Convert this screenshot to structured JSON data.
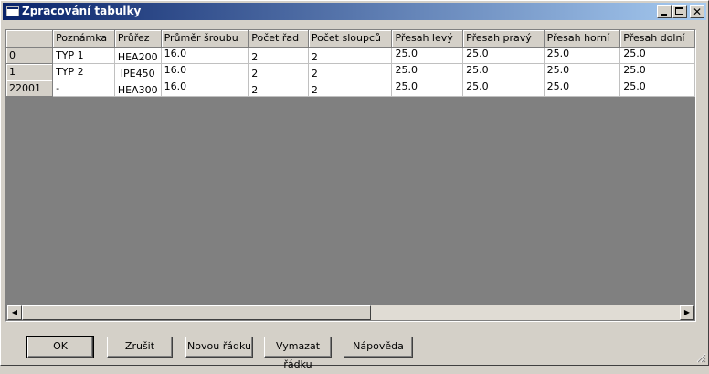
{
  "window": {
    "title": "Zpracování tabulky"
  },
  "grid": {
    "columns": [
      "",
      "Poznámka",
      "Průřez",
      "Průměr šroubu",
      "Počet řad",
      "Počet sloupců",
      "Přesah levý",
      "Přesah pravý",
      "Přesah horní",
      "Přesah dolní"
    ],
    "rows": [
      [
        "0",
        "TYP 1",
        "HEA200",
        "16.0",
        "2",
        "2",
        "25.0",
        "25.0",
        "25.0",
        "25.0"
      ],
      [
        "1",
        "TYP 2",
        "IPE450",
        "16.0",
        "2",
        "2",
        "25.0",
        "25.0",
        "25.0",
        "25.0"
      ],
      [
        "22001",
        "-",
        "HEA300",
        "16.0",
        "2",
        "2",
        "25.0",
        "25.0",
        "25.0",
        "25.0"
      ]
    ]
  },
  "buttons": {
    "ok": "OK",
    "cancel": "Zrušit",
    "new_row": "Novou řádku",
    "delete_row": "Vymazat řádku",
    "help": "Nápověda"
  },
  "icons": {
    "minimize": "minimize-icon",
    "maximize": "maximize-icon",
    "close": "close-icon",
    "scroll_left": "arrow-left-icon",
    "scroll_right": "arrow-right-icon"
  }
}
